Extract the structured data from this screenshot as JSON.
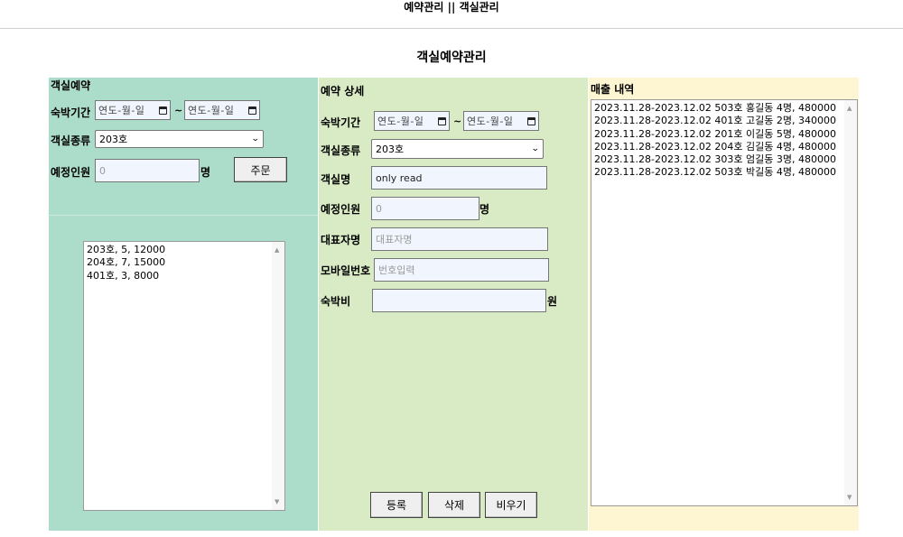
{
  "nav": {
    "link1": "예약관리",
    "separator": "||",
    "link2": "객실관리"
  },
  "page_title": "객실예약관리",
  "left": {
    "title": "객실예약",
    "stay_label": "숙박기간",
    "date_placeholder": "연도-월-일",
    "tilde": "~",
    "room_type_label": "객실종류",
    "room_type_value": "203호",
    "guests_label": "예정인원",
    "guests_placeholder": "0",
    "guests_unit": "명",
    "order_button": "주문",
    "room_list": [
      "203호, 5, 12000",
      "204호, 7, 15000",
      "401호, 3, 8000"
    ]
  },
  "middle": {
    "title": "예약 상세",
    "stay_label": "숙박기간",
    "date_placeholder": "연도-월-일",
    "tilde": "~",
    "room_type_label": "객실종류",
    "room_type_value": "203호",
    "room_name_label": "객실명",
    "room_name_value": "only read",
    "guests_label": "예정인원",
    "guests_placeholder": "0",
    "guests_unit": "명",
    "rep_label": "대표자명",
    "rep_placeholder": "대표자명",
    "mobile_label": "모바일번호",
    "mobile_placeholder": "번호입력",
    "fee_label": "숙박비",
    "fee_value": "",
    "fee_unit": "원",
    "register_button": "등록",
    "delete_button": "삭제",
    "clear_button": "비우기"
  },
  "right": {
    "title": "매출 내역",
    "sales": [
      "2023.11.28-2023.12.02 503호 홍길동 4명, 480000",
      "2023.11.28-2023.12.02 401호 고길동 2명, 340000",
      "2023.11.28-2023.12.02 201호 이길동 5명, 480000",
      "2023.11.28-2023.12.02 204호 김길동 4명, 480000",
      "2023.11.28-2023.12.02 303호 엄길동 3명, 480000",
      "2023.11.28-2023.12.02 503호 박길동 4명, 480000"
    ]
  }
}
